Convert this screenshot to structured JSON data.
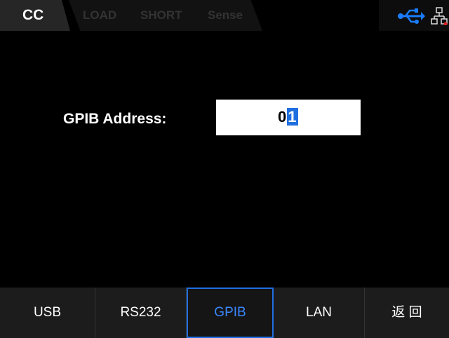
{
  "status_bar": {
    "mode": "CC",
    "words": [
      "LOAD",
      "SHORT",
      "Sense"
    ],
    "icons": [
      "usb-icon",
      "lan-icon"
    ]
  },
  "form": {
    "label": "GPIB Address:",
    "value_digit_1": "0",
    "value_digit_2": "1"
  },
  "softkeys": [
    "USB",
    "RS232",
    "GPIB",
    "LAN",
    "返 回"
  ],
  "active_softkey": "GPIB",
  "colors": {
    "accent": "#1f6fe0",
    "usb_icon": "#1a7dff",
    "lan_icon_dot": "#e02020"
  }
}
